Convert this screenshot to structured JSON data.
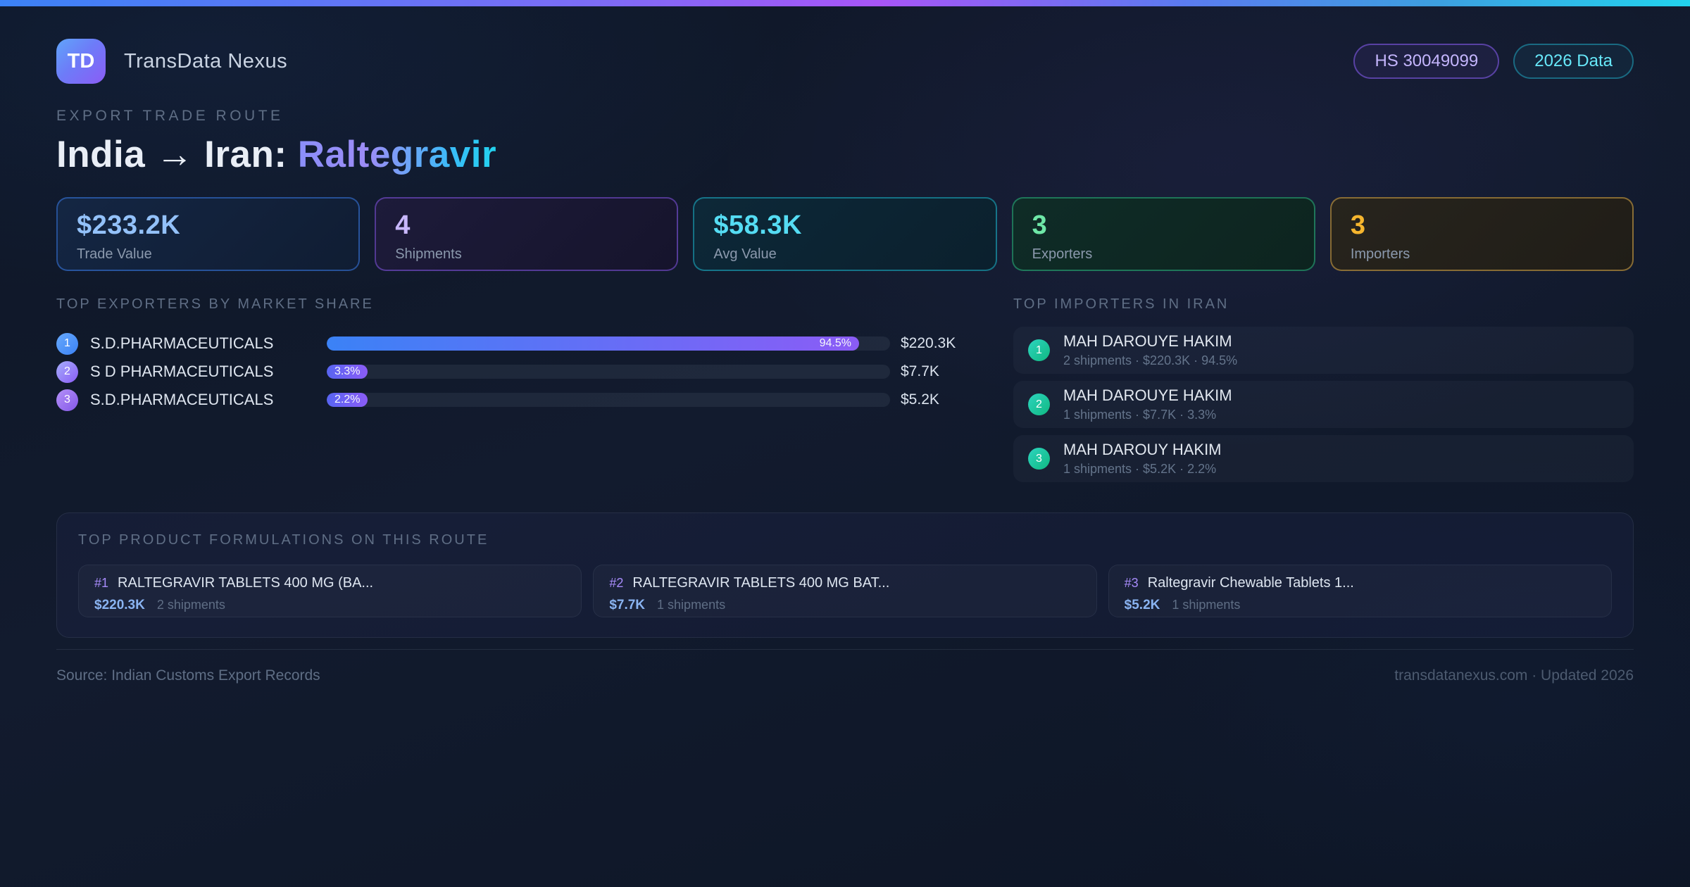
{
  "header": {
    "logo_text": "TD",
    "brand": "TransData Nexus",
    "hs_badge": "HS 30049099",
    "year_badge": "2026 Data"
  },
  "hero": {
    "eyebrow": "EXPORT TRADE ROUTE",
    "title_prefix": "India → Iran: ",
    "title_highlight": "Raltegravir"
  },
  "stats": [
    {
      "value": "$233.2K",
      "label": "Trade Value",
      "accent": "#3b82f6"
    },
    {
      "value": "4",
      "label": "Shipments",
      "accent": "#8b5cf6"
    },
    {
      "value": "$58.3K",
      "label": "Avg Value",
      "accent": "#22d3ee"
    },
    {
      "value": "3",
      "label": "Exporters",
      "accent": "#34d399"
    },
    {
      "value": "3",
      "label": "Importers",
      "accent": "#f5b52e"
    }
  ],
  "exporters": {
    "title": "TOP EXPORTERS BY MARKET SHARE",
    "rows": [
      {
        "rank": "1",
        "name": "S.D.PHARMACEUTICALS",
        "share_pct": 94.5,
        "share_label": "94.5%",
        "value": "$220.3K"
      },
      {
        "rank": "2",
        "name": "S D PHARMACEUTICALS",
        "share_pct": 3.3,
        "share_label": "3.3%",
        "value": "$7.7K"
      },
      {
        "rank": "3",
        "name": "S.D.PHARMACEUTICALS",
        "share_pct": 2.2,
        "share_label": "2.2%",
        "value": "$5.2K"
      }
    ]
  },
  "importers": {
    "title": "TOP IMPORTERS IN IRAN",
    "rows": [
      {
        "rank": "1",
        "name": "MAH DAROUYE HAKIM",
        "meta": "2 shipments · $220.3K · 94.5%"
      },
      {
        "rank": "2",
        "name": "MAH DAROUYE HAKIM",
        "meta": "1 shipments · $7.7K · 3.3%"
      },
      {
        "rank": "3",
        "name": "MAH DAROUY HAKIM",
        "meta": "1 shipments · $5.2K · 2.2%"
      }
    ]
  },
  "products": {
    "title": "TOP PRODUCT FORMULATIONS ON THIS ROUTE",
    "cards": [
      {
        "rank": "#1",
        "name": "RALTEGRAVIR TABLETS 400 MG (BA...",
        "value": "$220.3K",
        "shipments": "2 shipments"
      },
      {
        "rank": "#2",
        "name": "RALTEGRAVIR TABLETS 400 MG BAT...",
        "value": "$7.7K",
        "shipments": "1 shipments"
      },
      {
        "rank": "#3",
        "name": "Raltegravir Chewable Tablets 1...",
        "value": "$5.2K",
        "shipments": "1 shipments"
      }
    ]
  },
  "footer": {
    "source": "Source: Indian Customs Export Records",
    "site": "transdatanexus.com · Updated 2026"
  }
}
